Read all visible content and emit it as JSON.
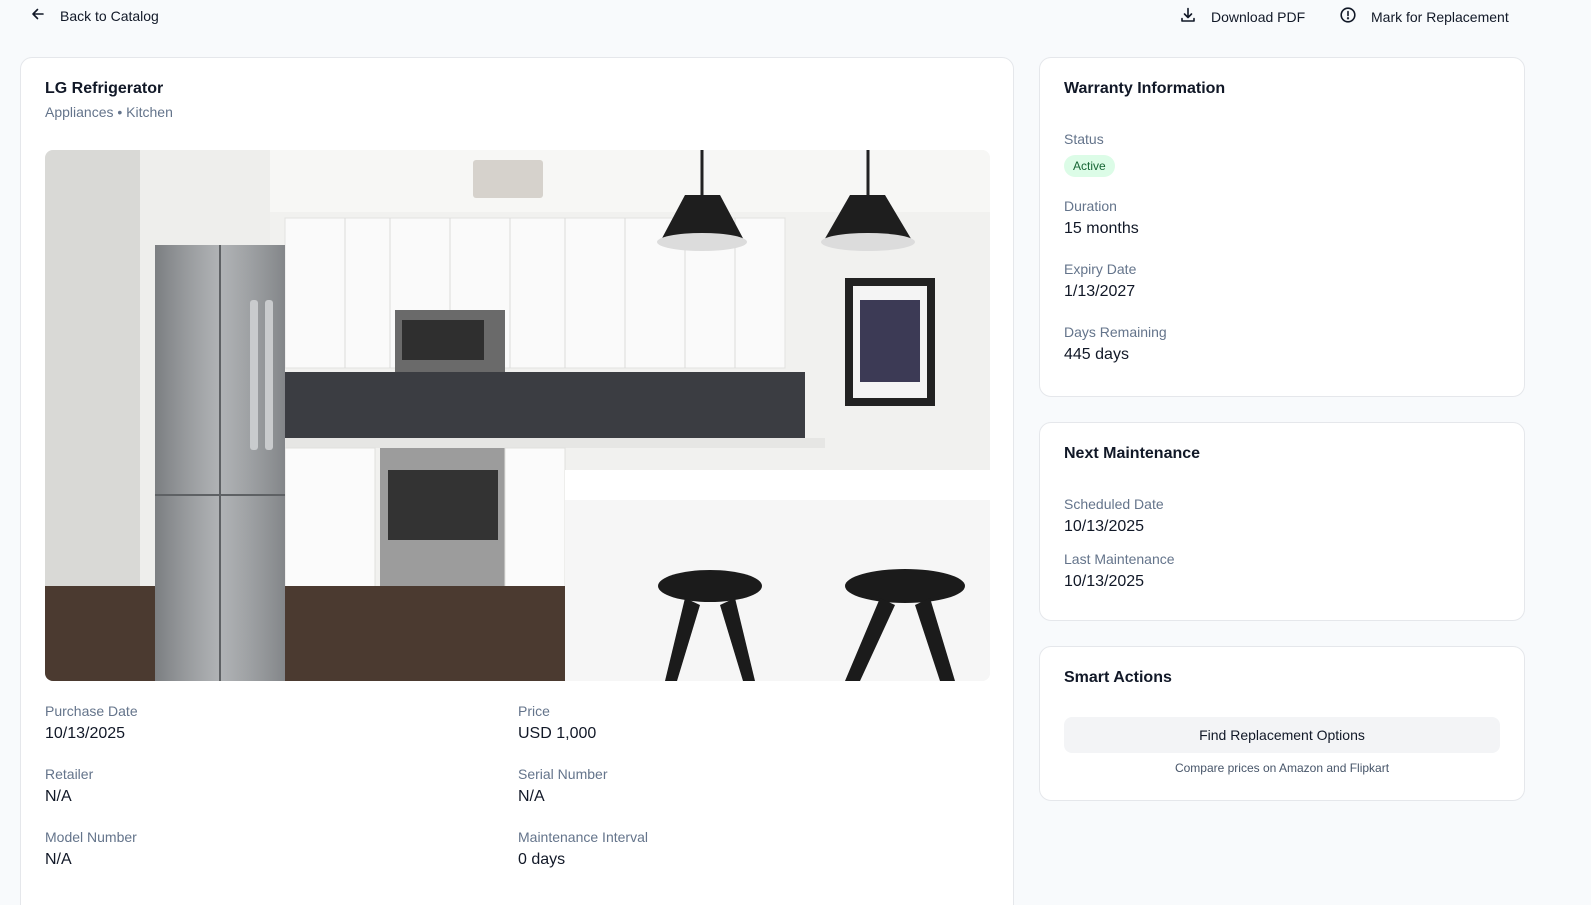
{
  "nav": {
    "back_label": "Back to Catalog",
    "download_label": "Download PDF",
    "mark_label": "Mark for Replacement"
  },
  "item": {
    "title": "LG Refrigerator",
    "subtitle": "Appliances • Kitchen",
    "image": "kitchen photo with stainless steel refrigerator, white cabinets, black pendant lamps and bar stools"
  },
  "details": [
    {
      "label": "Purchase Date",
      "value": "10/13/2025"
    },
    {
      "label": "Price",
      "value": "USD 1,000"
    },
    {
      "label": "Retailer",
      "value": "N/A"
    },
    {
      "label": "Serial Number",
      "value": "N/A"
    },
    {
      "label": "Model Number",
      "value": "N/A"
    },
    {
      "label": "Maintenance Interval",
      "value": "0 days"
    }
  ],
  "warranty": {
    "title": "Warranty Information",
    "status_label": "Status",
    "status_value": "Active",
    "duration_label": "Duration",
    "duration_value": "15 months",
    "expiry_label": "Expiry Date",
    "expiry_value": "1/13/2027",
    "remaining_label": "Days Remaining",
    "remaining_value": "445 days"
  },
  "maintenance": {
    "title": "Next Maintenance",
    "scheduled_label": "Scheduled Date",
    "scheduled_value": "10/13/2025",
    "last_label": "Last Maintenance",
    "last_value": "10/13/2025"
  },
  "smart": {
    "title": "Smart Actions",
    "button_label": "Find Replacement Options",
    "note": "Compare prices on Amazon and Flipkart"
  },
  "icons": {
    "back": "arrow-left-icon",
    "download": "download-icon",
    "alert": "alert-circle-icon"
  },
  "colors": {
    "background": "#f8fafc",
    "badge_bg": "#dcfce7",
    "badge_text": "#166534",
    "muted_text": "#64748b"
  }
}
